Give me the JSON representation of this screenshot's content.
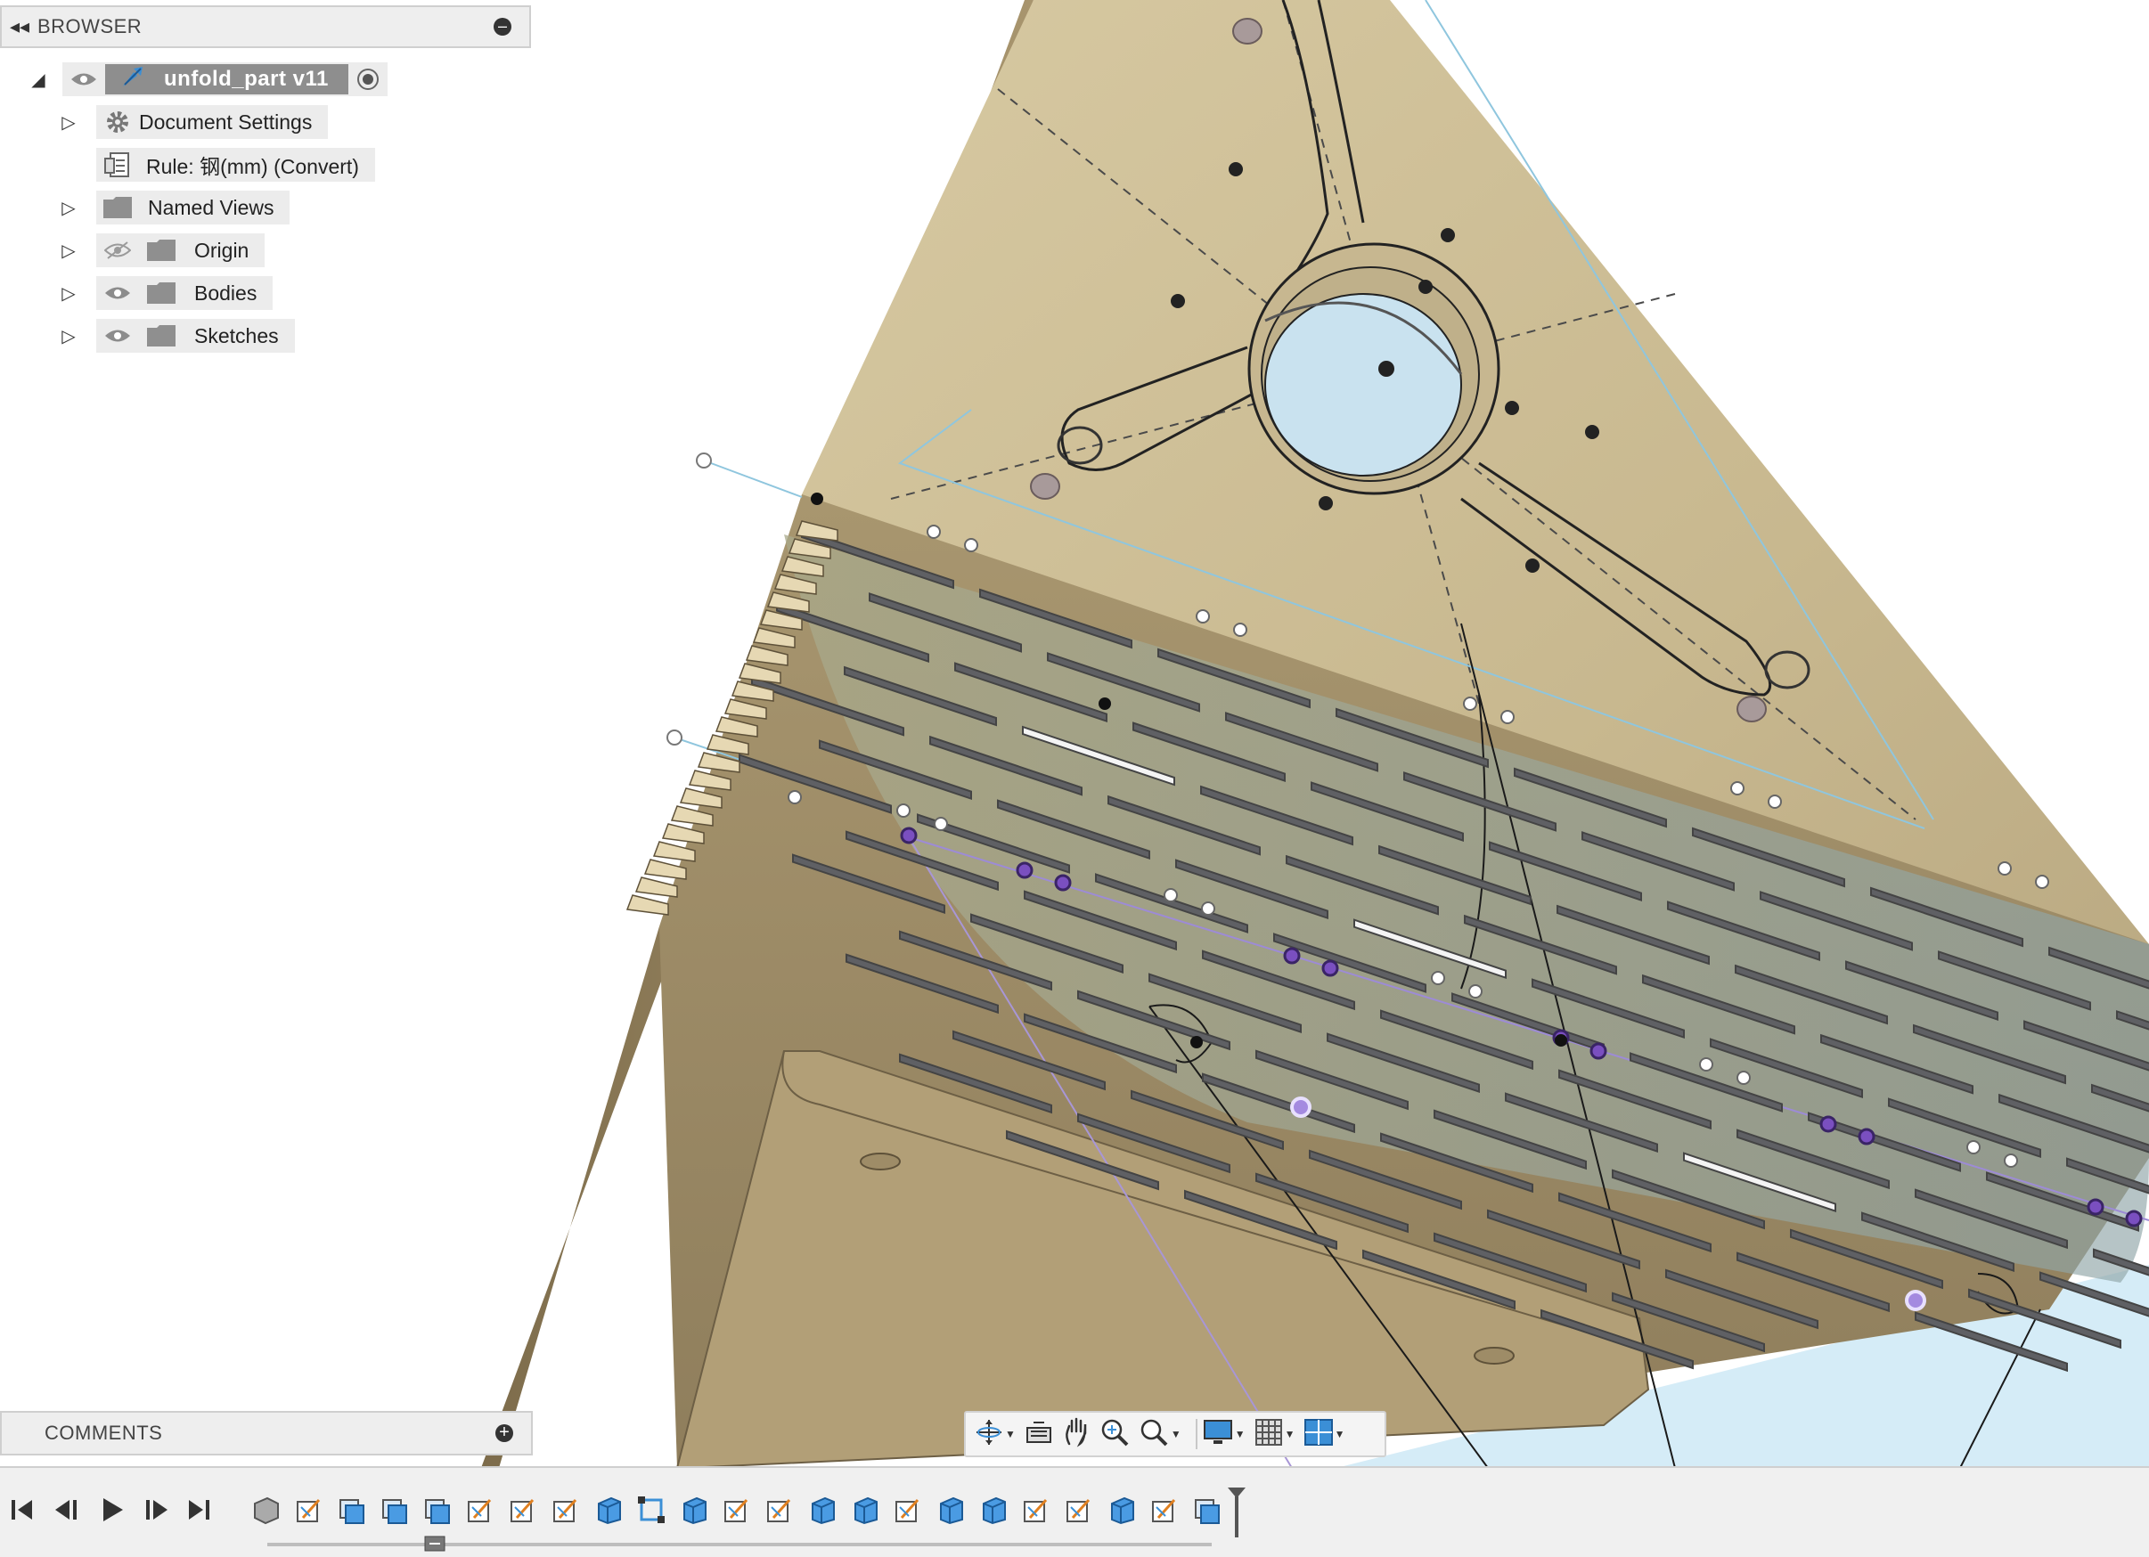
{
  "browser": {
    "title": "BROWSER",
    "collapse_icon": "double-chevron-left-icon",
    "minimize_icon": "minus-circle-icon",
    "root": {
      "name": "unfold_part v11",
      "icon": "component-icon",
      "active_radio": true
    },
    "items": [
      {
        "label": "Document Settings",
        "icon": "gear-icon",
        "expandable": true,
        "eye": false
      },
      {
        "label": "Rule: 钢(mm) (Convert)",
        "icon": "sheet-metal-rule-icon",
        "expandable": false,
        "eye": false
      },
      {
        "label": "Named Views",
        "icon": "folder-icon",
        "expandable": true,
        "eye": false
      },
      {
        "label": "Origin",
        "icon": "folder-icon",
        "expandable": true,
        "eye": "hidden"
      },
      {
        "label": "Bodies",
        "icon": "folder-icon",
        "expandable": true,
        "eye": "visible"
      },
      {
        "label": "Sketches",
        "icon": "folder-icon",
        "expandable": true,
        "eye": "visible"
      }
    ]
  },
  "comments": {
    "title": "COMMENTS",
    "add_icon": "plus-circle-icon"
  },
  "nav_toolbar": {
    "items": [
      "orbit-icon",
      "look-at-icon",
      "pan-icon",
      "zoom-icon",
      "zoom-window-icon",
      "display-settings-icon",
      "grid-settings-icon",
      "viewports-icon"
    ]
  },
  "timeline": {
    "controls": [
      "go-to-start-icon",
      "step-back-icon",
      "play-icon",
      "step-forward-icon",
      "go-to-end-icon"
    ],
    "feature_count": 23
  },
  "colors": {
    "part_face": "#cfc19a",
    "part_shadow": "#9d8b66",
    "accent_blue": "#3b8fd6",
    "sketch_point_purple": "#7a4fc0"
  }
}
